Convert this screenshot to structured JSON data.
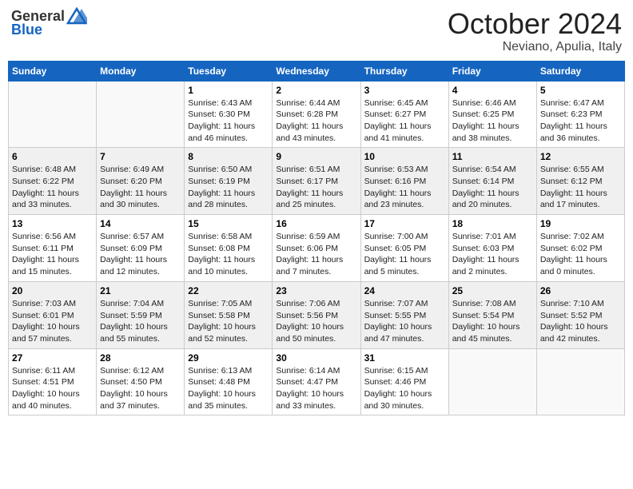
{
  "header": {
    "logo_general": "General",
    "logo_blue": "Blue",
    "month": "October 2024",
    "location": "Neviano, Apulia, Italy"
  },
  "weekdays": [
    "Sunday",
    "Monday",
    "Tuesday",
    "Wednesday",
    "Thursday",
    "Friday",
    "Saturday"
  ],
  "weeks": [
    [
      {
        "day": "",
        "sunrise": "",
        "sunset": "",
        "daylight": "",
        "empty": true
      },
      {
        "day": "",
        "sunrise": "",
        "sunset": "",
        "daylight": "",
        "empty": true
      },
      {
        "day": "1",
        "sunrise": "Sunrise: 6:43 AM",
        "sunset": "Sunset: 6:30 PM",
        "daylight": "Daylight: 11 hours and 46 minutes."
      },
      {
        "day": "2",
        "sunrise": "Sunrise: 6:44 AM",
        "sunset": "Sunset: 6:28 PM",
        "daylight": "Daylight: 11 hours and 43 minutes."
      },
      {
        "day": "3",
        "sunrise": "Sunrise: 6:45 AM",
        "sunset": "Sunset: 6:27 PM",
        "daylight": "Daylight: 11 hours and 41 minutes."
      },
      {
        "day": "4",
        "sunrise": "Sunrise: 6:46 AM",
        "sunset": "Sunset: 6:25 PM",
        "daylight": "Daylight: 11 hours and 38 minutes."
      },
      {
        "day": "5",
        "sunrise": "Sunrise: 6:47 AM",
        "sunset": "Sunset: 6:23 PM",
        "daylight": "Daylight: 11 hours and 36 minutes."
      }
    ],
    [
      {
        "day": "6",
        "sunrise": "Sunrise: 6:48 AM",
        "sunset": "Sunset: 6:22 PM",
        "daylight": "Daylight: 11 hours and 33 minutes."
      },
      {
        "day": "7",
        "sunrise": "Sunrise: 6:49 AM",
        "sunset": "Sunset: 6:20 PM",
        "daylight": "Daylight: 11 hours and 30 minutes."
      },
      {
        "day": "8",
        "sunrise": "Sunrise: 6:50 AM",
        "sunset": "Sunset: 6:19 PM",
        "daylight": "Daylight: 11 hours and 28 minutes."
      },
      {
        "day": "9",
        "sunrise": "Sunrise: 6:51 AM",
        "sunset": "Sunset: 6:17 PM",
        "daylight": "Daylight: 11 hours and 25 minutes."
      },
      {
        "day": "10",
        "sunrise": "Sunrise: 6:53 AM",
        "sunset": "Sunset: 6:16 PM",
        "daylight": "Daylight: 11 hours and 23 minutes."
      },
      {
        "day": "11",
        "sunrise": "Sunrise: 6:54 AM",
        "sunset": "Sunset: 6:14 PM",
        "daylight": "Daylight: 11 hours and 20 minutes."
      },
      {
        "day": "12",
        "sunrise": "Sunrise: 6:55 AM",
        "sunset": "Sunset: 6:12 PM",
        "daylight": "Daylight: 11 hours and 17 minutes."
      }
    ],
    [
      {
        "day": "13",
        "sunrise": "Sunrise: 6:56 AM",
        "sunset": "Sunset: 6:11 PM",
        "daylight": "Daylight: 11 hours and 15 minutes."
      },
      {
        "day": "14",
        "sunrise": "Sunrise: 6:57 AM",
        "sunset": "Sunset: 6:09 PM",
        "daylight": "Daylight: 11 hours and 12 minutes."
      },
      {
        "day": "15",
        "sunrise": "Sunrise: 6:58 AM",
        "sunset": "Sunset: 6:08 PM",
        "daylight": "Daylight: 11 hours and 10 minutes."
      },
      {
        "day": "16",
        "sunrise": "Sunrise: 6:59 AM",
        "sunset": "Sunset: 6:06 PM",
        "daylight": "Daylight: 11 hours and 7 minutes."
      },
      {
        "day": "17",
        "sunrise": "Sunrise: 7:00 AM",
        "sunset": "Sunset: 6:05 PM",
        "daylight": "Daylight: 11 hours and 5 minutes."
      },
      {
        "day": "18",
        "sunrise": "Sunrise: 7:01 AM",
        "sunset": "Sunset: 6:03 PM",
        "daylight": "Daylight: 11 hours and 2 minutes."
      },
      {
        "day": "19",
        "sunrise": "Sunrise: 7:02 AM",
        "sunset": "Sunset: 6:02 PM",
        "daylight": "Daylight: 11 hours and 0 minutes."
      }
    ],
    [
      {
        "day": "20",
        "sunrise": "Sunrise: 7:03 AM",
        "sunset": "Sunset: 6:01 PM",
        "daylight": "Daylight: 10 hours and 57 minutes."
      },
      {
        "day": "21",
        "sunrise": "Sunrise: 7:04 AM",
        "sunset": "Sunset: 5:59 PM",
        "daylight": "Daylight: 10 hours and 55 minutes."
      },
      {
        "day": "22",
        "sunrise": "Sunrise: 7:05 AM",
        "sunset": "Sunset: 5:58 PM",
        "daylight": "Daylight: 10 hours and 52 minutes."
      },
      {
        "day": "23",
        "sunrise": "Sunrise: 7:06 AM",
        "sunset": "Sunset: 5:56 PM",
        "daylight": "Daylight: 10 hours and 50 minutes."
      },
      {
        "day": "24",
        "sunrise": "Sunrise: 7:07 AM",
        "sunset": "Sunset: 5:55 PM",
        "daylight": "Daylight: 10 hours and 47 minutes."
      },
      {
        "day": "25",
        "sunrise": "Sunrise: 7:08 AM",
        "sunset": "Sunset: 5:54 PM",
        "daylight": "Daylight: 10 hours and 45 minutes."
      },
      {
        "day": "26",
        "sunrise": "Sunrise: 7:10 AM",
        "sunset": "Sunset: 5:52 PM",
        "daylight": "Daylight: 10 hours and 42 minutes."
      }
    ],
    [
      {
        "day": "27",
        "sunrise": "Sunrise: 6:11 AM",
        "sunset": "Sunset: 4:51 PM",
        "daylight": "Daylight: 10 hours and 40 minutes."
      },
      {
        "day": "28",
        "sunrise": "Sunrise: 6:12 AM",
        "sunset": "Sunset: 4:50 PM",
        "daylight": "Daylight: 10 hours and 37 minutes."
      },
      {
        "day": "29",
        "sunrise": "Sunrise: 6:13 AM",
        "sunset": "Sunset: 4:48 PM",
        "daylight": "Daylight: 10 hours and 35 minutes."
      },
      {
        "day": "30",
        "sunrise": "Sunrise: 6:14 AM",
        "sunset": "Sunset: 4:47 PM",
        "daylight": "Daylight: 10 hours and 33 minutes."
      },
      {
        "day": "31",
        "sunrise": "Sunrise: 6:15 AM",
        "sunset": "Sunset: 4:46 PM",
        "daylight": "Daylight: 10 hours and 30 minutes."
      },
      {
        "day": "",
        "sunrise": "",
        "sunset": "",
        "daylight": "",
        "empty": true
      },
      {
        "day": "",
        "sunrise": "",
        "sunset": "",
        "daylight": "",
        "empty": true
      }
    ]
  ]
}
